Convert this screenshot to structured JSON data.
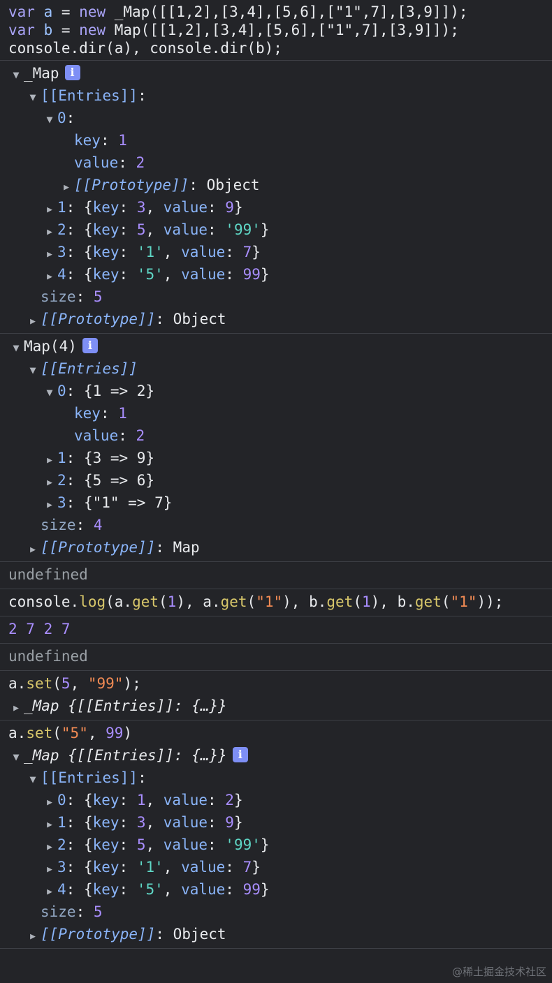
{
  "code_input": {
    "line1": {
      "kw": "var",
      "name": " a ",
      "eq": "= ",
      "kw2": "new",
      "rest": " _Map([[1,2],[3,4],[5,6],[\"1\",7],[3,9]]);"
    },
    "line2": {
      "kw": "var",
      "name": " b ",
      "eq": "= ",
      "kw2": "new",
      "rest": " Map([[1,2],[3,4],[5,6],[\"1\",7],[3,9]]);"
    },
    "line3": "console.dir(a), console.dir(b);"
  },
  "dir_a": {
    "title": "_Map",
    "info": "i",
    "entries_label": "[[Entries]]",
    "entry0": {
      "index": "0",
      "key_label": "key",
      "key_val": "1",
      "value_label": "value",
      "value_val": "2",
      "proto_label": "[[Prototype]]",
      "proto_val": "Object"
    },
    "rows": [
      {
        "index": "1",
        "key": "3",
        "value": "9",
        "key_is_str": false,
        "value_is_str": false
      },
      {
        "index": "2",
        "key": "5",
        "value": "'99'",
        "key_is_str": false,
        "value_is_str": true
      },
      {
        "index": "3",
        "key": "'1'",
        "value": "7",
        "key_is_str": true,
        "value_is_str": false
      },
      {
        "index": "4",
        "key": "'5'",
        "value": "99",
        "key_is_str": true,
        "value_is_str": false
      }
    ],
    "size_label": "size",
    "size_val": "5",
    "proto_label": "[[Prototype]]",
    "proto_val": "Object"
  },
  "dir_b": {
    "title": "Map(4)",
    "info": "i",
    "entries_label": "[[Entries]]",
    "entry0": {
      "index": "0",
      "summary": "{1 => 2}",
      "key_label": "key",
      "key_val": "1",
      "value_label": "value",
      "value_val": "2"
    },
    "rows": [
      {
        "index": "1",
        "summary": "{3 => 9}"
      },
      {
        "index": "2",
        "summary": "{5 => 6}"
      },
      {
        "index": "3",
        "summary": "{\"1\" => 7}"
      }
    ],
    "size_label": "size",
    "size_val": "4",
    "proto_label": "[[Prototype]]",
    "proto_val": "Map"
  },
  "undefined_1": "undefined",
  "log_input": {
    "obj": "console",
    "fn": "log",
    "args": [
      {
        "obj": "a",
        "fn": "get",
        "arg": "1",
        "is_str": false
      },
      {
        "obj": "a",
        "fn": "get",
        "arg": "\"1\"",
        "is_str": true
      },
      {
        "obj": "b",
        "fn": "get",
        "arg": "1",
        "is_str": false
      },
      {
        "obj": "b",
        "fn": "get",
        "arg": "\"1\"",
        "is_str": true
      }
    ]
  },
  "log_output": "2 7 2 7",
  "undefined_2": "undefined",
  "set1_input": {
    "obj": "a",
    "fn": "set",
    "arg1": "5",
    "arg2": "\"99\"",
    "end": ");"
  },
  "set1_output": {
    "title": "_Map",
    "summary": "{[[Entries]]: {…}}"
  },
  "set2_input": {
    "obj": "a",
    "fn": "set",
    "arg1": "\"5\"",
    "arg2": "99",
    "end": ")"
  },
  "set2_output": {
    "title": "_Map",
    "summary": "{[[Entries]]: {…}}",
    "info": "i",
    "entries_label": "[[Entries]]",
    "rows": [
      {
        "index": "0",
        "key": "1",
        "value": "2",
        "key_is_str": false,
        "value_is_str": false
      },
      {
        "index": "1",
        "key": "3",
        "value": "9",
        "key_is_str": false,
        "value_is_str": false
      },
      {
        "index": "2",
        "key": "5",
        "value": "'99'",
        "key_is_str": false,
        "value_is_str": true
      },
      {
        "index": "3",
        "key": "'1'",
        "value": "7",
        "key_is_str": true,
        "value_is_str": false
      },
      {
        "index": "4",
        "key": "'5'",
        "value": "99",
        "key_is_str": true,
        "value_is_str": false
      }
    ],
    "size_label": "size",
    "size_val": "5",
    "proto_label": "[[Prototype]]",
    "proto_val": "Object"
  },
  "watermark": "@稀土掘金技术社区",
  "colors": {
    "background": "#232428",
    "number": "#a98eff",
    "string": "#5fd7c6",
    "string_literal": "#f28b54",
    "property": "#8ab4f8",
    "info_badge": "#7e8ff5"
  }
}
